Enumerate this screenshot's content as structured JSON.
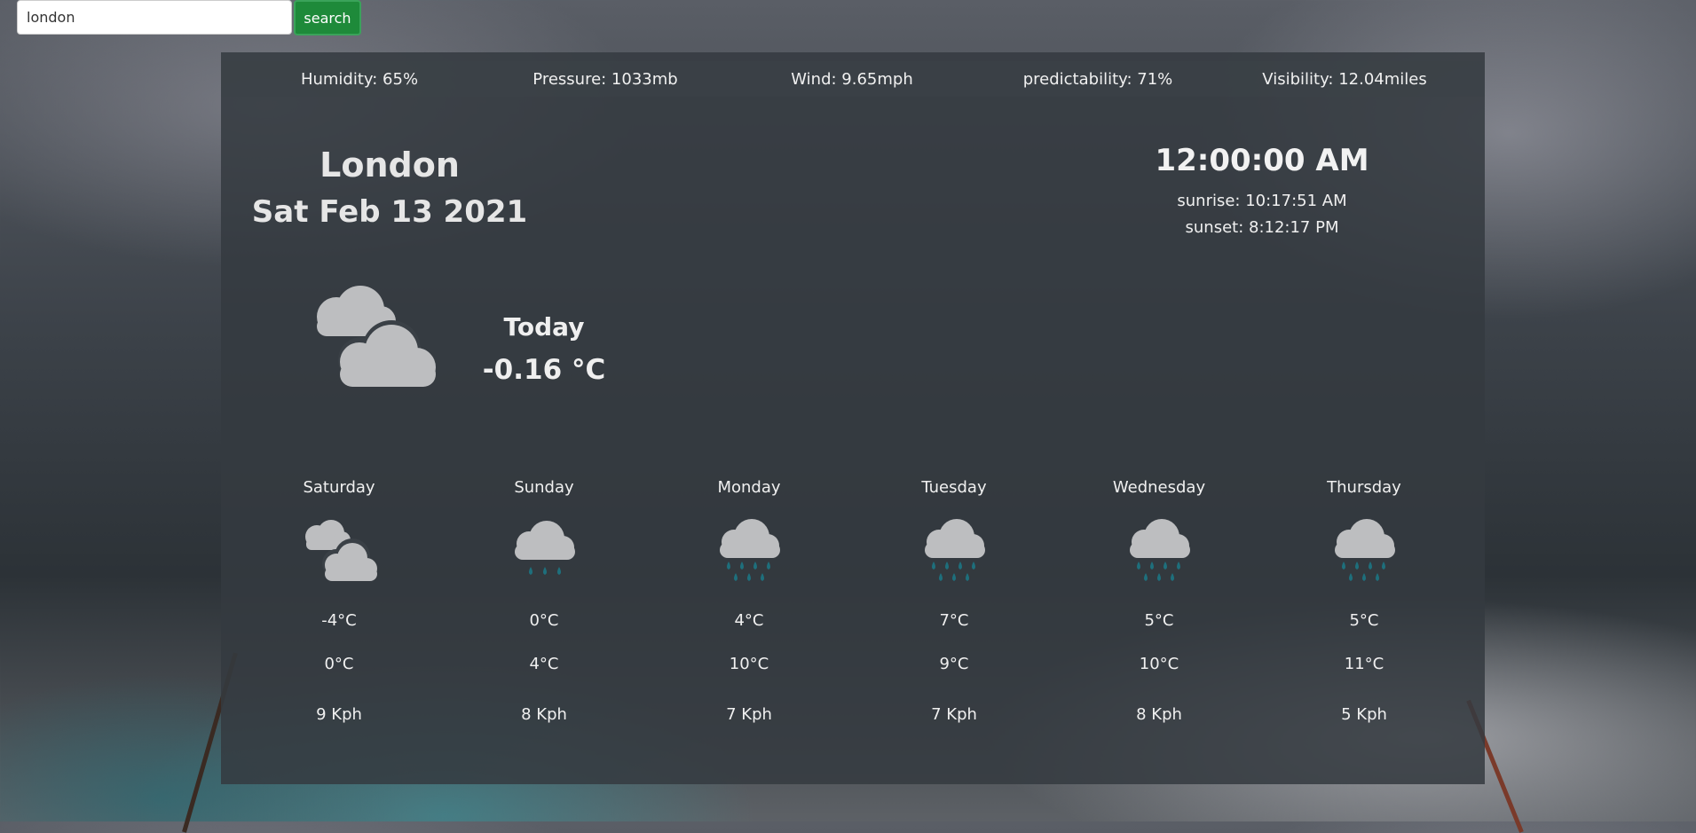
{
  "search": {
    "value": "london",
    "button_label": "search"
  },
  "stats": {
    "humidity": "Humidity: 65%",
    "pressure": "Pressure: 1033mb",
    "wind": "Wind: 9.65mph",
    "predictability": "predictability: 71%",
    "visibility": "Visibility: 12.04miles"
  },
  "location": {
    "city": "London",
    "date": "Sat Feb 13 2021"
  },
  "time": {
    "clock": "12:00:00 AM",
    "sunrise": "sunrise: 10:17:51 AM",
    "sunset": "sunset: 8:12:17 PM"
  },
  "today": {
    "label": "Today",
    "temp": "-0.16 °C",
    "icon": "partly-cloudy-icon"
  },
  "forecast": [
    {
      "day": "Saturday",
      "icon": "clouds-icon",
      "low": "-4°C",
      "high": "0°C",
      "wind": "9 Kph"
    },
    {
      "day": "Sunday",
      "icon": "light-rain-icon",
      "low": "0°C",
      "high": "4°C",
      "wind": "8 Kph"
    },
    {
      "day": "Monday",
      "icon": "rain-icon",
      "low": "4°C",
      "high": "10°C",
      "wind": "7 Kph"
    },
    {
      "day": "Tuesday",
      "icon": "rain-icon",
      "low": "7°C",
      "high": "9°C",
      "wind": "7 Kph"
    },
    {
      "day": "Wednesday",
      "icon": "rain-icon",
      "low": "5°C",
      "high": "10°C",
      "wind": "8 Kph"
    },
    {
      "day": "Thursday",
      "icon": "rain-icon",
      "low": "5°C",
      "high": "11°C",
      "wind": "5 Kph"
    }
  ],
  "colors": {
    "search_button": "#1e8a3a",
    "panel": "#343a40",
    "cloud": "#bdbec0",
    "raindrop": "#1e6f7c"
  }
}
